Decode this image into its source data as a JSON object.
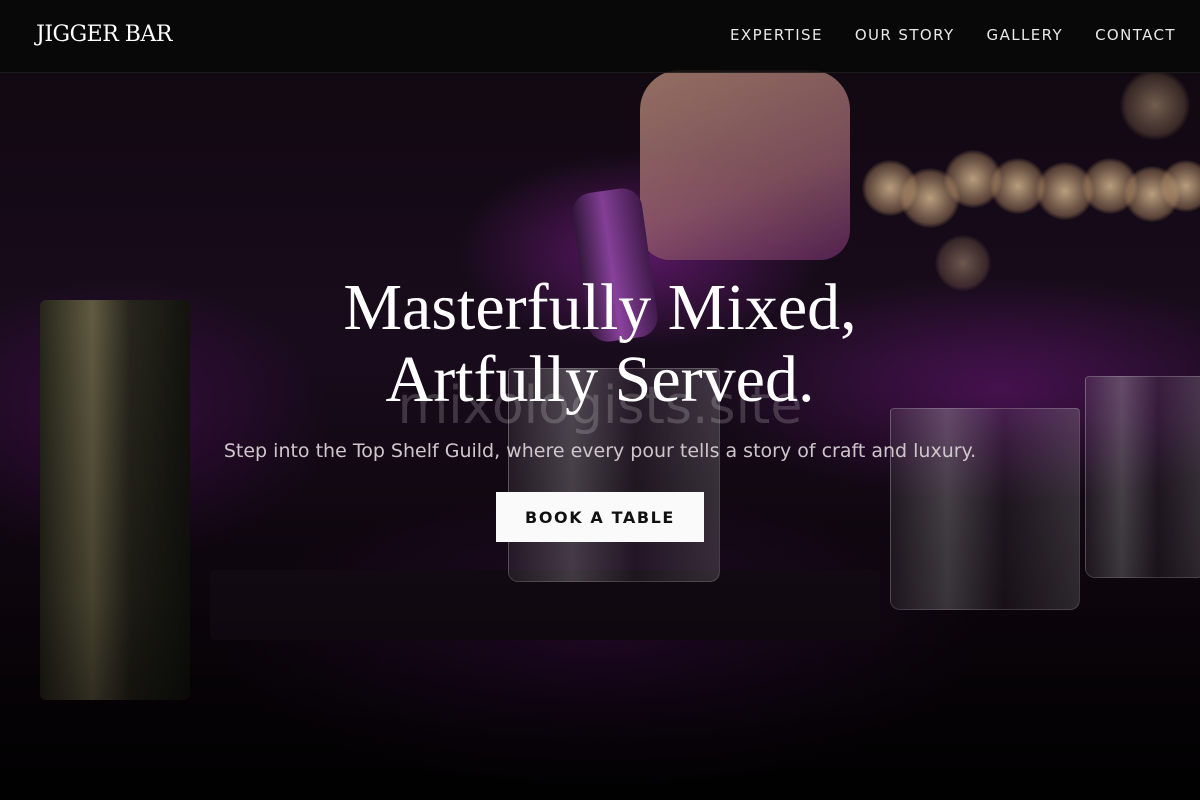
{
  "brand": {
    "name": "JIGGER BAR"
  },
  "nav": {
    "items": [
      {
        "label": "EXPERTISE"
      },
      {
        "label": "OUR STORY"
      },
      {
        "label": "GALLERY"
      },
      {
        "label": "CONTACT"
      }
    ]
  },
  "hero": {
    "headline_line1": "Masterfully Mixed,",
    "headline_line2": "Artfully Served.",
    "watermark": "mixologists.site",
    "subtitle": "Step into the Top Shelf Guild, where every pour tells a story of craft and luxury.",
    "cta_label": "BOOK A TABLE"
  },
  "colors": {
    "accent_purple": "#9a2fb0",
    "nav_bg": "#080808",
    "button_bg": "#fafafa"
  }
}
